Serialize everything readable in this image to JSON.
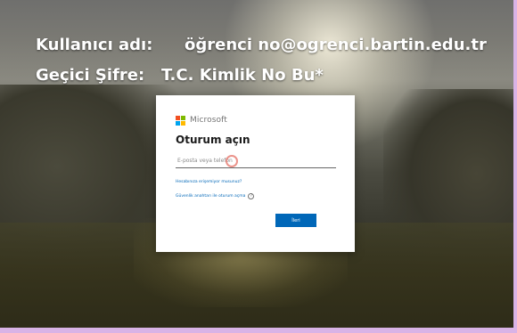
{
  "overlay": {
    "username_label": "Kullanıcı adı:",
    "username_value": "öğrenci no@ogrenci.bartin.edu.tr",
    "password_label": "Geçici Şifre:",
    "password_value": "T.C. Kimlik No Bu*"
  },
  "signin": {
    "brand": "Microsoft",
    "title": "Oturum açın",
    "email_placeholder": "E-posta veya telefon",
    "cant_access_link": "Hesabınıza erişemiyor musunuz?",
    "security_key_link": "Güvenlik anahtarı ile oturum açma",
    "help_icon_glyph": "?",
    "next_button": "İleri",
    "brand_colors": {
      "red": "#f25022",
      "green": "#7fba00",
      "blue": "#00a4ef",
      "yellow": "#ffb900"
    },
    "accent_color": "#0067b8"
  },
  "icons": {
    "logo": "microsoft-logo-icon",
    "help": "help-circle-icon"
  }
}
